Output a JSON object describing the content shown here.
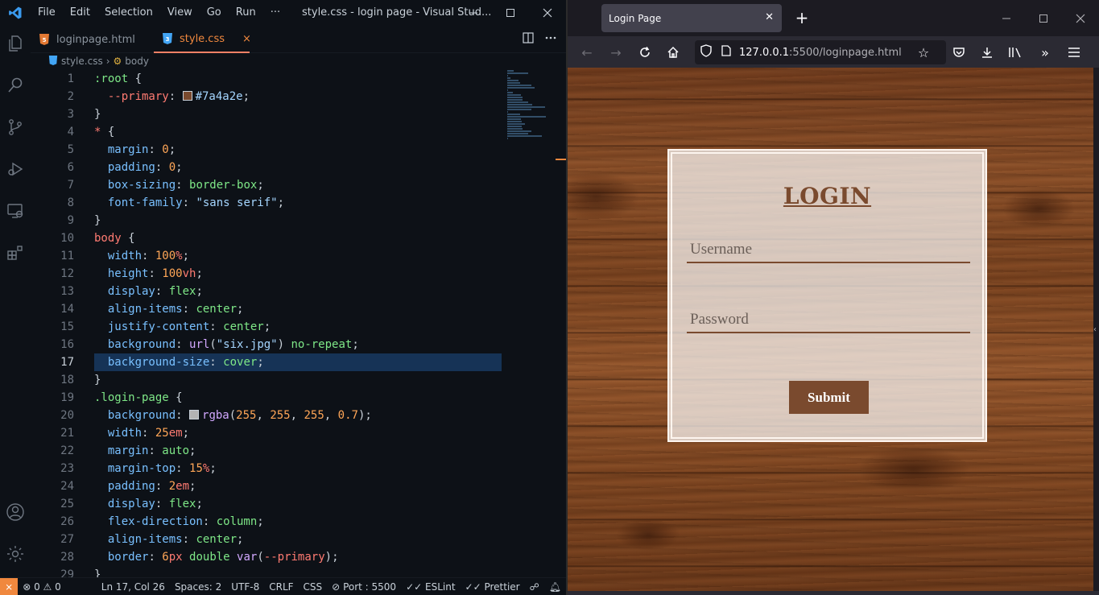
{
  "vscode": {
    "menu": [
      "File",
      "Edit",
      "Selection",
      "View",
      "Go",
      "Run",
      "···"
    ],
    "window_title": "style.css - login page - Visual Stud...",
    "tabs": [
      {
        "label": "loginpage.html",
        "active": false
      },
      {
        "label": "style.css",
        "active": true,
        "close": "×"
      }
    ],
    "breadcrumb": {
      "file": "style.css",
      "symbol": "body"
    },
    "active_line": 17,
    "code_lines": [
      [
        {
          "t": ":root",
          "c": "sel"
        },
        {
          "t": " {",
          "c": "punc"
        }
      ],
      [
        {
          "t": "  --primary",
          "c": "selp"
        },
        {
          "t": ": ",
          "c": "punc"
        },
        {
          "t": "",
          "c": "swatch",
          "color": "#7a4a2e"
        },
        {
          "t": "#7a4a2e",
          "c": "val"
        },
        {
          "t": ";",
          "c": "punc"
        }
      ],
      [
        {
          "t": "}",
          "c": "punc"
        }
      ],
      [
        {
          "t": "*",
          "c": "selp"
        },
        {
          "t": " {",
          "c": "punc"
        }
      ],
      [
        {
          "t": "  margin",
          "c": "prop"
        },
        {
          "t": ": ",
          "c": "punc"
        },
        {
          "t": "0",
          "c": "num"
        },
        {
          "t": ";",
          "c": "punc"
        }
      ],
      [
        {
          "t": "  padding",
          "c": "prop"
        },
        {
          "t": ": ",
          "c": "punc"
        },
        {
          "t": "0",
          "c": "num"
        },
        {
          "t": ";",
          "c": "punc"
        }
      ],
      [
        {
          "t": "  box-sizing",
          "c": "prop"
        },
        {
          "t": ": ",
          "c": "punc"
        },
        {
          "t": "border-box",
          "c": "kw"
        },
        {
          "t": ";",
          "c": "punc"
        }
      ],
      [
        {
          "t": "  font-family",
          "c": "prop"
        },
        {
          "t": ": ",
          "c": "punc"
        },
        {
          "t": "\"sans serif\"",
          "c": "str"
        },
        {
          "t": ";",
          "c": "punc"
        }
      ],
      [
        {
          "t": "}",
          "c": "punc"
        }
      ],
      [
        {
          "t": "body",
          "c": "selp"
        },
        {
          "t": " {",
          "c": "punc"
        }
      ],
      [
        {
          "t": "  width",
          "c": "prop"
        },
        {
          "t": ": ",
          "c": "punc"
        },
        {
          "t": "100",
          "c": "num"
        },
        {
          "t": "%",
          "c": "unit"
        },
        {
          "t": ";",
          "c": "punc"
        }
      ],
      [
        {
          "t": "  height",
          "c": "prop"
        },
        {
          "t": ": ",
          "c": "punc"
        },
        {
          "t": "100",
          "c": "num"
        },
        {
          "t": "vh",
          "c": "unit"
        },
        {
          "t": ";",
          "c": "punc"
        }
      ],
      [
        {
          "t": "  display",
          "c": "prop"
        },
        {
          "t": ": ",
          "c": "punc"
        },
        {
          "t": "flex",
          "c": "kw"
        },
        {
          "t": ";",
          "c": "punc"
        }
      ],
      [
        {
          "t": "  align-items",
          "c": "prop"
        },
        {
          "t": ": ",
          "c": "punc"
        },
        {
          "t": "center",
          "c": "kw"
        },
        {
          "t": ";",
          "c": "punc"
        }
      ],
      [
        {
          "t": "  justify-content",
          "c": "prop"
        },
        {
          "t": ": ",
          "c": "punc"
        },
        {
          "t": "center",
          "c": "kw"
        },
        {
          "t": ";",
          "c": "punc"
        }
      ],
      [
        {
          "t": "  background",
          "c": "prop"
        },
        {
          "t": ": ",
          "c": "punc"
        },
        {
          "t": "url",
          "c": "fn"
        },
        {
          "t": "(",
          "c": "punc"
        },
        {
          "t": "\"six.jpg\"",
          "c": "str"
        },
        {
          "t": ") ",
          "c": "punc"
        },
        {
          "t": "no-repeat",
          "c": "kw"
        },
        {
          "t": ";",
          "c": "punc"
        }
      ],
      [
        {
          "t": "  background-size",
          "c": "prop"
        },
        {
          "t": ": ",
          "c": "punc"
        },
        {
          "t": "cover",
          "c": "kw"
        },
        {
          "t": ";",
          "c": "punc"
        }
      ],
      [
        {
          "t": "}",
          "c": "punc"
        }
      ],
      [
        {
          "t": ".login-page",
          "c": "sel"
        },
        {
          "t": " {",
          "c": "punc"
        }
      ],
      [
        {
          "t": "  background",
          "c": "prop"
        },
        {
          "t": ": ",
          "c": "punc"
        },
        {
          "t": "",
          "c": "swatch",
          "color": "#b3b3b3"
        },
        {
          "t": "rgba",
          "c": "fn"
        },
        {
          "t": "(",
          "c": "punc"
        },
        {
          "t": "255",
          "c": "num"
        },
        {
          "t": ", ",
          "c": "punc"
        },
        {
          "t": "255",
          "c": "num"
        },
        {
          "t": ", ",
          "c": "punc"
        },
        {
          "t": "255",
          "c": "num"
        },
        {
          "t": ", ",
          "c": "punc"
        },
        {
          "t": "0.7",
          "c": "num"
        },
        {
          "t": ");",
          "c": "punc"
        }
      ],
      [
        {
          "t": "  width",
          "c": "prop"
        },
        {
          "t": ": ",
          "c": "punc"
        },
        {
          "t": "25",
          "c": "num"
        },
        {
          "t": "em",
          "c": "unit"
        },
        {
          "t": ";",
          "c": "punc"
        }
      ],
      [
        {
          "t": "  margin",
          "c": "prop"
        },
        {
          "t": ": ",
          "c": "punc"
        },
        {
          "t": "auto",
          "c": "kw"
        },
        {
          "t": ";",
          "c": "punc"
        }
      ],
      [
        {
          "t": "  margin-top",
          "c": "prop"
        },
        {
          "t": ": ",
          "c": "punc"
        },
        {
          "t": "15",
          "c": "num"
        },
        {
          "t": "%",
          "c": "unit"
        },
        {
          "t": ";",
          "c": "punc"
        }
      ],
      [
        {
          "t": "  padding",
          "c": "prop"
        },
        {
          "t": ": ",
          "c": "punc"
        },
        {
          "t": "2",
          "c": "num"
        },
        {
          "t": "em",
          "c": "unit"
        },
        {
          "t": ";",
          "c": "punc"
        }
      ],
      [
        {
          "t": "  display",
          "c": "prop"
        },
        {
          "t": ": ",
          "c": "punc"
        },
        {
          "t": "flex",
          "c": "kw"
        },
        {
          "t": ";",
          "c": "punc"
        }
      ],
      [
        {
          "t": "  flex-direction",
          "c": "prop"
        },
        {
          "t": ": ",
          "c": "punc"
        },
        {
          "t": "column",
          "c": "kw"
        },
        {
          "t": ";",
          "c": "punc"
        }
      ],
      [
        {
          "t": "  align-items",
          "c": "prop"
        },
        {
          "t": ": ",
          "c": "punc"
        },
        {
          "t": "center",
          "c": "kw"
        },
        {
          "t": ";",
          "c": "punc"
        }
      ],
      [
        {
          "t": "  border",
          "c": "prop"
        },
        {
          "t": ": ",
          "c": "punc"
        },
        {
          "t": "6",
          "c": "num"
        },
        {
          "t": "px",
          "c": "unit"
        },
        {
          "t": " ",
          "c": "punc"
        },
        {
          "t": "double",
          "c": "kw"
        },
        {
          "t": " ",
          "c": "punc"
        },
        {
          "t": "var",
          "c": "fn"
        },
        {
          "t": "(",
          "c": "punc"
        },
        {
          "t": "--primary",
          "c": "selp"
        },
        {
          "t": ");",
          "c": "punc"
        }
      ],
      [
        {
          "t": "}",
          "c": "punc"
        }
      ]
    ],
    "status": {
      "errors": "0",
      "warnings": "0",
      "position": "Ln 17, Col 26",
      "spaces": "Spaces: 2",
      "encoding": "UTF-8",
      "eol": "CRLF",
      "language": "CSS",
      "port": "Port : 5500",
      "eslint": "ESLint",
      "prettier": "Prettier"
    }
  },
  "browser": {
    "tab_title": "Login Page",
    "url_host": "127.0.0.1",
    "url_rest": ":5500/loginpage.html"
  },
  "page": {
    "heading": "LOGIN",
    "username_placeholder": "Username",
    "password_placeholder": "Password",
    "submit_label": "Submit"
  },
  "colors": {
    "primary": "#7a4a2e",
    "accent_orange": "#f0883e"
  }
}
